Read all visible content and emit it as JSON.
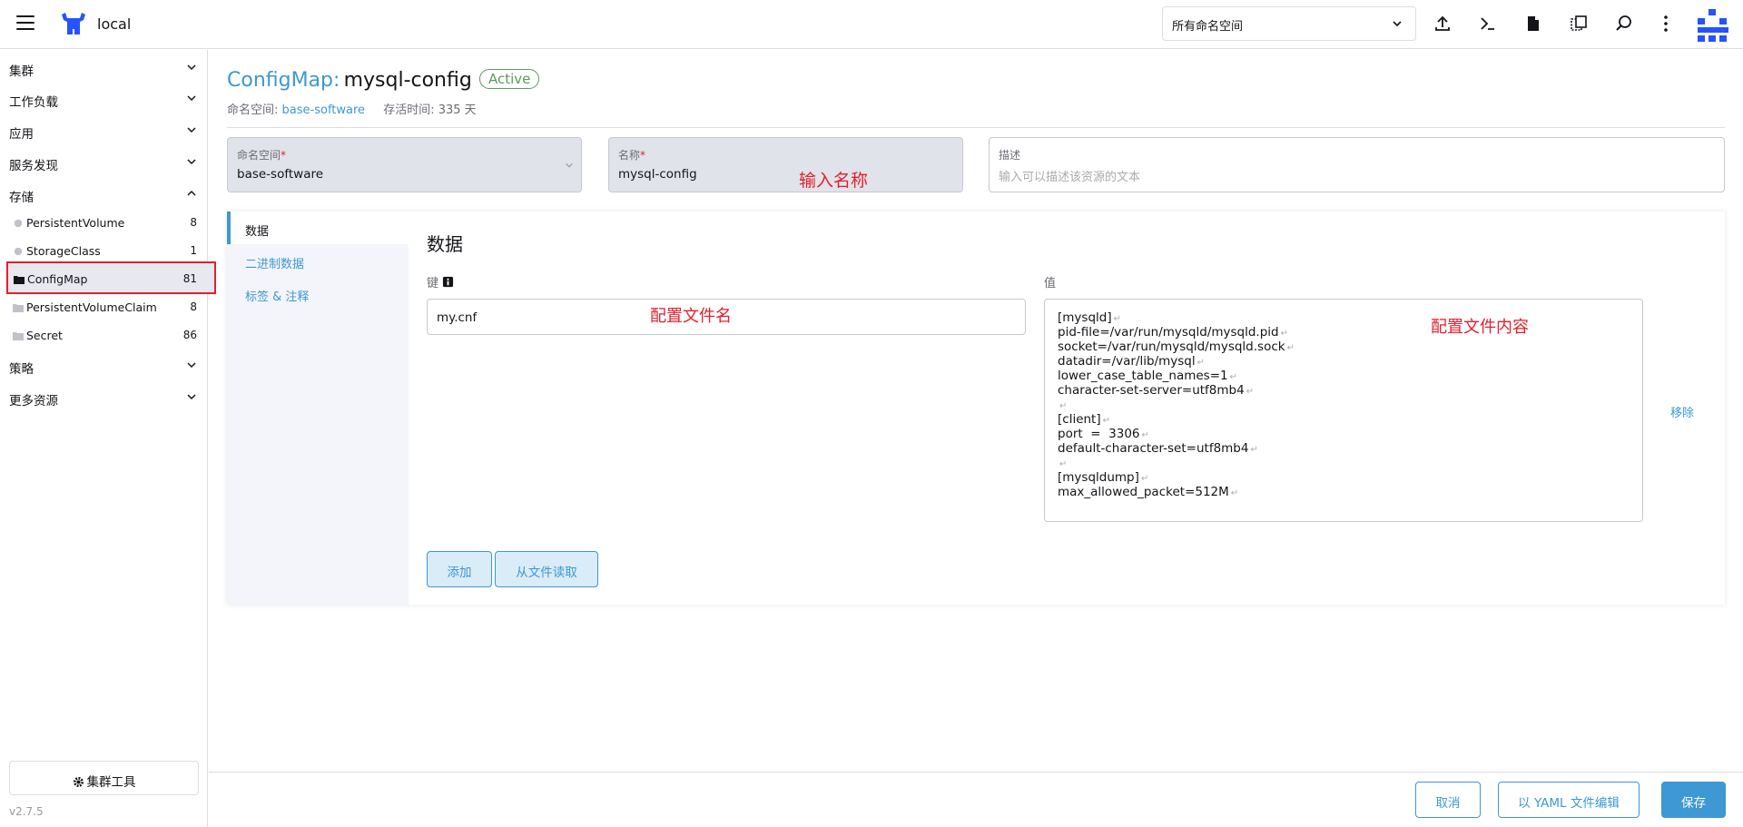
{
  "header": {
    "cluster_name": "local",
    "namespace_select": "所有命名空间",
    "icons": [
      "upload-icon",
      "terminal-icon",
      "file-icon",
      "copy-icon",
      "search-icon",
      "more-vertical-icon",
      "user-avatar-icon"
    ]
  },
  "sidebar": {
    "groups": [
      {
        "label": "集群"
      },
      {
        "label": "工作负载"
      },
      {
        "label": "应用"
      },
      {
        "label": "服务发现"
      },
      {
        "label": "存储"
      },
      {
        "label": "策略"
      },
      {
        "label": "更多资源"
      }
    ],
    "storage_items": [
      {
        "label": "PersistentVolume",
        "count": "8"
      },
      {
        "label": "StorageClass",
        "count": "1"
      },
      {
        "label": "ConfigMap",
        "count": "81"
      },
      {
        "label": "PersistentVolumeClaim",
        "count": "8"
      },
      {
        "label": "Secret",
        "count": "86"
      }
    ],
    "tools_button": "集群工具",
    "version": "v2.7.5"
  },
  "page": {
    "kind": "ConfigMap:",
    "name": "mysql-config",
    "status": "Active",
    "ns_label": "命名空间:",
    "ns_value": "base-software",
    "age_label": "存活时间: 335 天"
  },
  "form": {
    "namespace": {
      "label": "命名空间",
      "required": "*",
      "value": "base-software"
    },
    "name": {
      "label": "名称",
      "required": "*",
      "value": "mysql-config"
    },
    "description": {
      "label": "描述",
      "placeholder": "输入可以描述该资源的文本"
    }
  },
  "annotations": {
    "name_hint": "输入名称",
    "key_hint": "配置文件名",
    "value_hint": "配置文件内容"
  },
  "tabs": [
    {
      "label": "数据"
    },
    {
      "label": "二进制数据"
    },
    {
      "label": "标签 & 注释"
    }
  ],
  "data_section": {
    "title": "数据",
    "key_label": "键",
    "value_label": "值",
    "key": "my.cnf",
    "value_lines": [
      "[mysqld]",
      "pid-file=/var/run/mysqld/mysqld.pid",
      "socket=/var/run/mysqld/mysqld.sock",
      "datadir=/var/lib/mysql",
      "lower_case_table_names=1",
      "character-set-server=utf8mb4",
      "",
      "[client]",
      "port  =  3306",
      "default-character-set=utf8mb4",
      "",
      "[mysqldump]",
      "max_allowed_packet=512M"
    ],
    "remove": "移除",
    "add_button": "添加",
    "read_file_button": "从文件读取"
  },
  "footer": {
    "cancel": "取消",
    "edit_yaml": "以 YAML 文件编辑",
    "save": "保存"
  },
  "colors": {
    "accent": "#3d98d3",
    "active_green": "#5d995d",
    "annotation_red": "#e41e2c"
  }
}
